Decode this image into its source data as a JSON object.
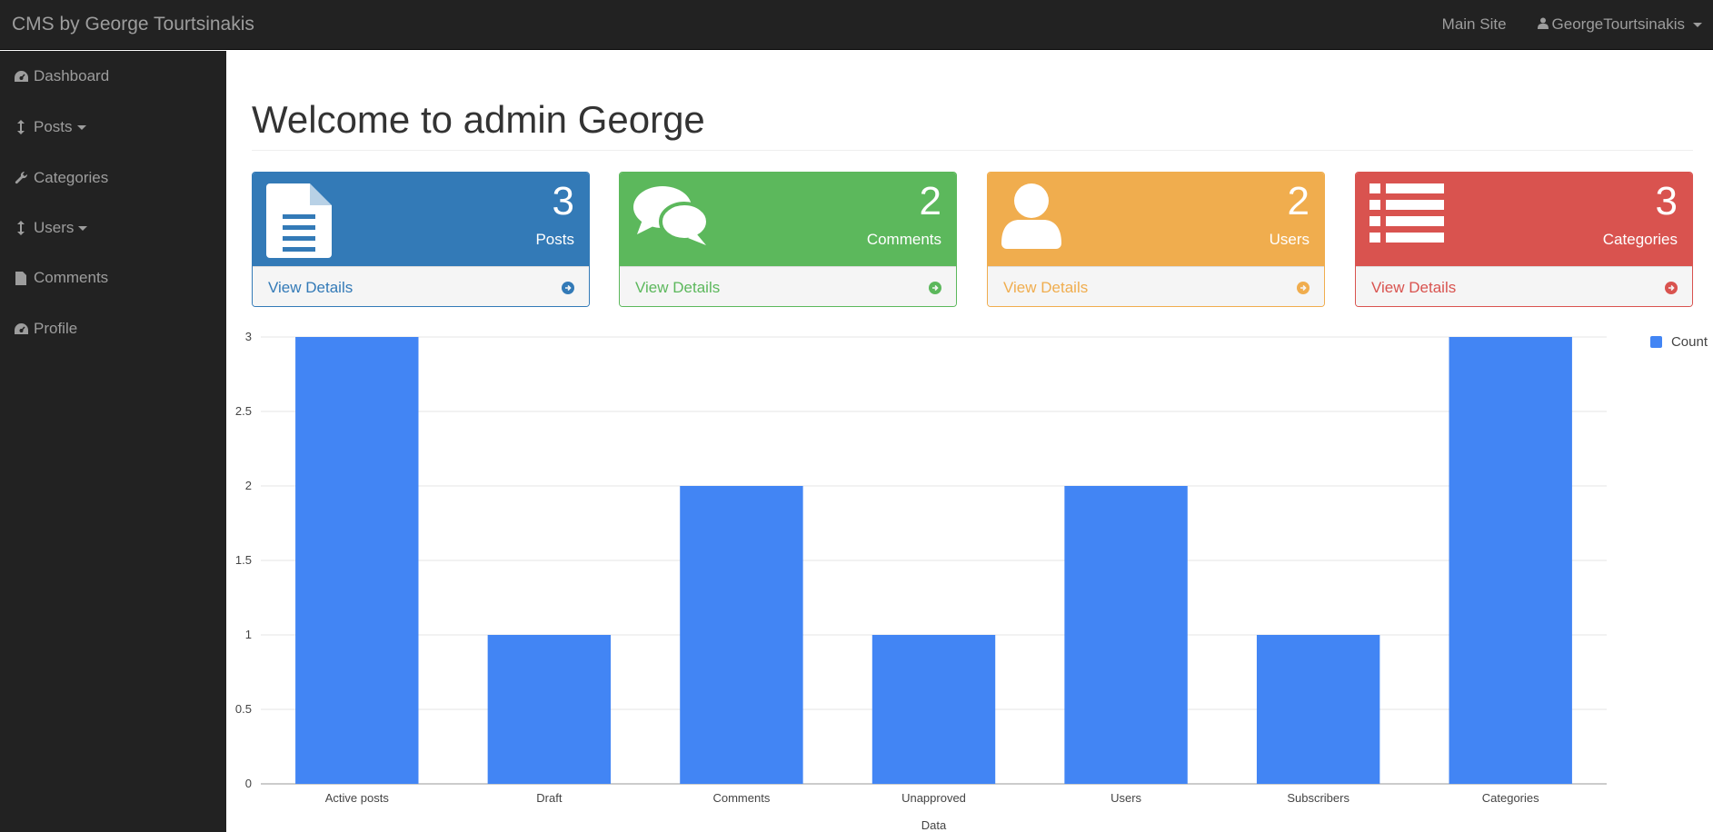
{
  "app": {
    "brand": "CMS by George Tourtsinakis",
    "main_site": "Main Site",
    "user": "GeorgeTourtsinakis"
  },
  "sidebar": {
    "items": [
      {
        "label": "Dashboard",
        "icon": "dashboard-icon"
      },
      {
        "label": "Posts",
        "icon": "arrows-v-icon",
        "dropdown": true
      },
      {
        "label": "Categories",
        "icon": "wrench-icon"
      },
      {
        "label": "Users",
        "icon": "arrows-v-icon",
        "dropdown": true
      },
      {
        "label": "Comments",
        "icon": "file-icon"
      },
      {
        "label": "Profile",
        "icon": "dashboard-icon"
      }
    ]
  },
  "main": {
    "title": "Welcome to admin George"
  },
  "panels": [
    {
      "count": "3",
      "label": "Posts",
      "link": "View Details",
      "color": "#337ab7",
      "icon": "file-text-icon"
    },
    {
      "count": "2",
      "label": "Comments",
      "link": "View Details",
      "color": "#5cb85c",
      "icon": "comments-icon"
    },
    {
      "count": "2",
      "label": "Users",
      "link": "View Details",
      "color": "#f0ad4e",
      "icon": "user-icon"
    },
    {
      "count": "3",
      "label": "Categories",
      "link": "View Details",
      "color": "#d9534f",
      "icon": "list-icon"
    }
  ],
  "chart_data": {
    "type": "bar",
    "categories": [
      "Active posts",
      "Draft",
      "Comments",
      "Unapproved",
      "Users",
      "Subscribers",
      "Categories"
    ],
    "series": [
      {
        "name": "Count",
        "values": [
          3,
          1,
          2,
          1,
          2,
          1,
          3
        ],
        "color": "#4285f4"
      }
    ],
    "xlabel": "Data",
    "ylabel": "",
    "ylim": [
      0,
      3
    ],
    "yticks": [
      "0",
      "0.5",
      "1",
      "1.5",
      "2",
      "2.5",
      "3"
    ],
    "grid": true,
    "legend": "top-right"
  }
}
